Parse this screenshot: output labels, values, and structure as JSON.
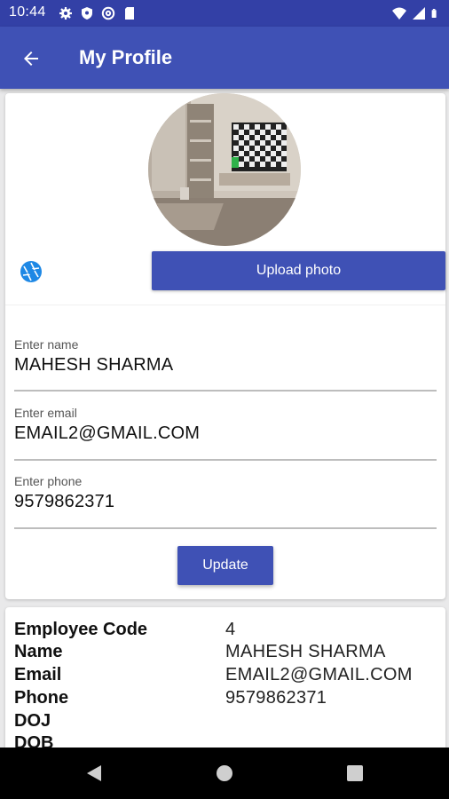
{
  "status_bar": {
    "time": "10:44",
    "left_icons": [
      "gear-icon",
      "shield-icon",
      "at-sign-icon",
      "sd-card-icon"
    ],
    "right_icons": [
      "wifi-icon",
      "signal-icon",
      "battery-icon"
    ]
  },
  "app_bar": {
    "title": "My Profile",
    "back_icon": "arrow-left-icon",
    "color": "#3f51b5"
  },
  "profile": {
    "photo": "room-photo",
    "camera_icon": "camera-aperture-icon",
    "upload_label": "Upload photo"
  },
  "form": {
    "name": {
      "label": "Enter name",
      "value": "MAHESH SHARMA"
    },
    "email": {
      "label": "Enter email",
      "value": "EMAIL2@GMAIL.COM"
    },
    "phone": {
      "label": "Enter phone",
      "value": "9579862371"
    },
    "update_label": "Update"
  },
  "details": {
    "rows": [
      {
        "key": "Employee Code",
        "value": "4"
      },
      {
        "key": "Name",
        "value": "MAHESH SHARMA"
      },
      {
        "key": "Email",
        "value": "EMAIL2@GMAIL.COM"
      },
      {
        "key": "Phone",
        "value": "9579862371"
      },
      {
        "key": "DOJ",
        "value": ""
      },
      {
        "key": "DOB",
        "value": ""
      }
    ]
  },
  "nav_bar": {
    "buttons": [
      "back-triangle-icon",
      "home-circle-icon",
      "recents-square-icon"
    ]
  }
}
